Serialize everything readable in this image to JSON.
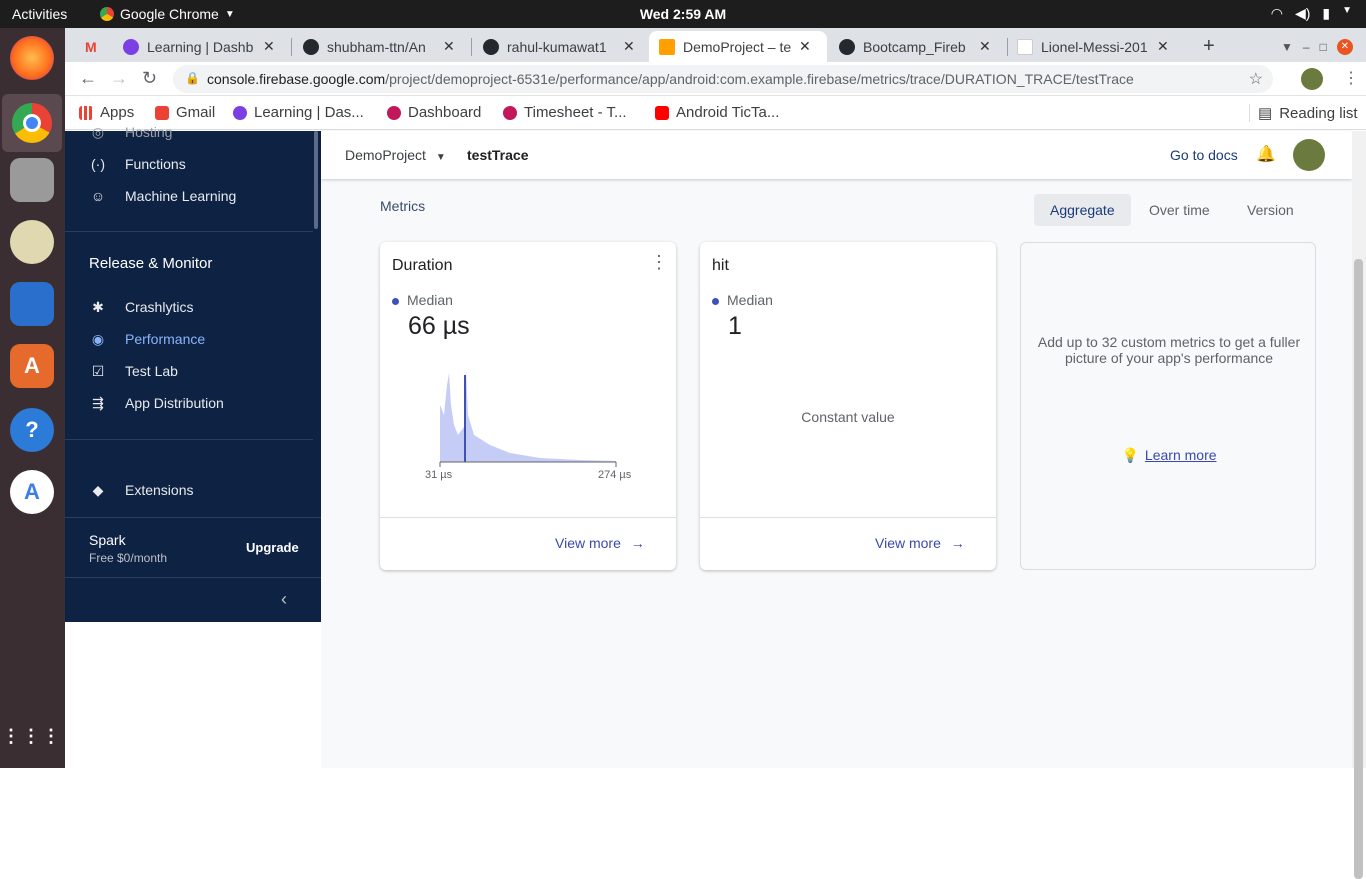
{
  "os": {
    "activities": "Activities",
    "app_name": "Google Chrome",
    "clock": "Wed  2:59 AM"
  },
  "tabs": [
    {
      "label": "Learning | Dashb",
      "color": "#7b3fe4"
    },
    {
      "label": "shubham-ttn/An",
      "color": "#24292e"
    },
    {
      "label": "rahul-kumawat1",
      "color": "#24292e"
    },
    {
      "label": "DemoProject – te",
      "color": "#ffa000"
    },
    {
      "label": "Bootcamp_Fireb",
      "color": "#24292e"
    },
    {
      "label": "Lionel-Messi-201",
      "color": "#ffffff"
    }
  ],
  "address": {
    "host": "console.firebase.google.com",
    "path": "/project/demoproject-6531e/performance/app/android:com.example.firebase/metrics/trace/DURATION_TRACE/testTrace"
  },
  "bookmarks": [
    {
      "label": "Apps",
      "color": "#ea4335"
    },
    {
      "label": "Gmail",
      "color": "#ea4335"
    },
    {
      "label": "Learning | Das...",
      "color": "#7b3fe4"
    },
    {
      "label": "Dashboard",
      "color": "#c2185b"
    },
    {
      "label": "Timesheet - T...",
      "color": "#c2185b"
    },
    {
      "label": "Android TicTa...",
      "color": "#ff0000"
    }
  ],
  "reading_list": "Reading list",
  "sidebar": {
    "hosting": "Hosting",
    "functions": "Functions",
    "ml": "Machine Learning",
    "section": "Release & Monitor",
    "crashlytics": "Crashlytics",
    "performance": "Performance",
    "testlab": "Test Lab",
    "appdist": "App Distribution",
    "extensions": "Extensions",
    "plan": "Spark",
    "plan_price": "Free $0/month",
    "upgrade": "Upgrade"
  },
  "header": {
    "project": "DemoProject",
    "trace": "testTrace",
    "docs": "Go to docs"
  },
  "metrics_label": "Metrics",
  "segments": [
    "Aggregate",
    "Over time",
    "Version"
  ],
  "cards": {
    "duration": {
      "title": "Duration",
      "stat_label": "Median",
      "value": "66 µs",
      "axis_min": "31 µs",
      "axis_max": "274 µs",
      "view_more": "View more"
    },
    "hit": {
      "title": "hit",
      "stat_label": "Median",
      "value": "1",
      "note": "Constant value",
      "view_more": "View more"
    },
    "custom": {
      "text": "Add up to 32 custom metrics to get a fuller picture of your app's performance",
      "link": "Learn more"
    }
  },
  "colors": {
    "accent": "#3f51b5",
    "sidebar": "#0e2244",
    "selected_nav": "#8ab4f8"
  }
}
